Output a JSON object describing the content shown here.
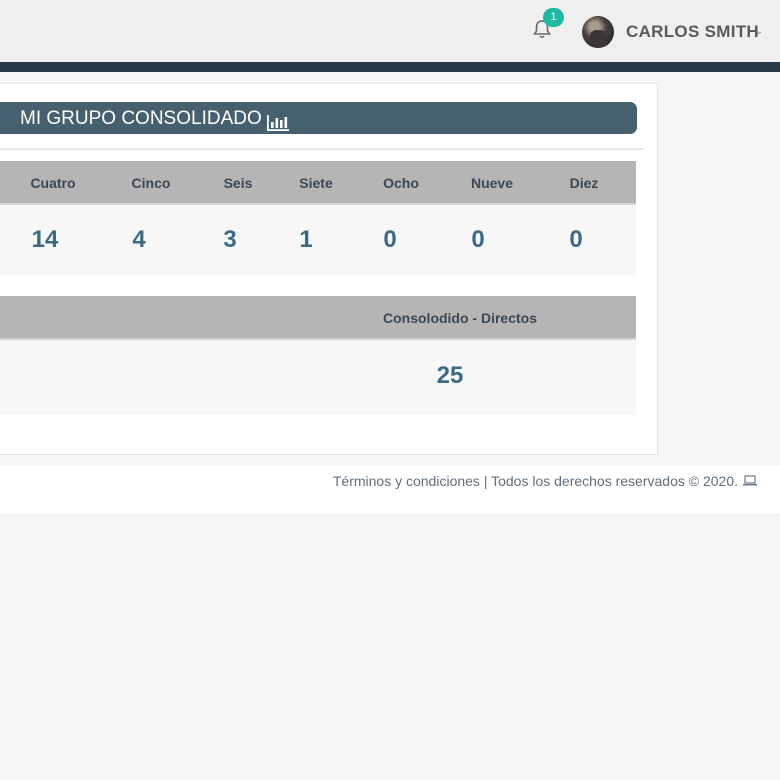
{
  "header": {
    "notification_count": "1",
    "user_name": "CARLOS SMITH",
    "user_menu_icon": "chevron-down-icon",
    "bell_icon": "bell-icon"
  },
  "section": {
    "title": "MI GRUPO CONSOLIDADO",
    "title_icon": "bar-chart-icon",
    "accent_color": "#47606f"
  },
  "levels_table": {
    "headers": [
      "Cuatro",
      "Cinco",
      "Seis",
      "Siete",
      "Ocho",
      "Nueve",
      "Diez"
    ],
    "values": [
      "14",
      "4",
      "3",
      "1",
      "0",
      "0",
      "0"
    ]
  },
  "consolidated_table": {
    "header": "Consolodido - Directos",
    "value": "25"
  },
  "footer": {
    "terms_link": "Términos y condiciones",
    "separator": "|",
    "rights_text": "Todos los derechos reservados © 2020.",
    "icon": "laptop-icon"
  }
}
